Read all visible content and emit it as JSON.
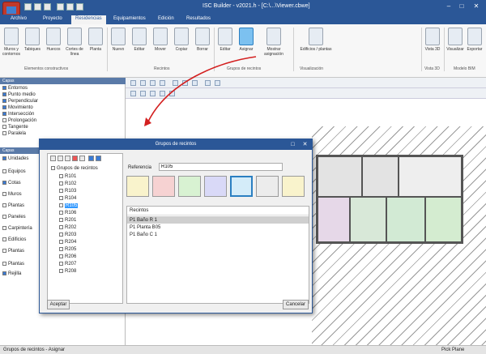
{
  "window": {
    "title": "ISC Builder - v2021.h - [C:\\...\\Viewer.cbwe]"
  },
  "tabs": [
    "Archivo",
    "Proyecto",
    "Residencias",
    "Equipamientos",
    "Edición",
    "Resultados"
  ],
  "ribbon": {
    "buttons": [
      "Muros y contornos",
      "Tabiques",
      "Huecos",
      "Cortes de línea",
      "Planta",
      "Nuevo",
      "Editar",
      "Mover",
      "Copiar",
      "Borrar",
      "Editar",
      "Asignar",
      "Mostrar asignación",
      "Edificios / plantas",
      "Vista 3D",
      "Visualizar",
      "Exportar"
    ],
    "groups": [
      "Elementos constructivos",
      "Recintos",
      "Grupos de recintos",
      "Visualización",
      "Vista 3D",
      "Modelo BIM"
    ]
  },
  "left_panel": {
    "header": "Capas",
    "items": [
      "Entornos",
      "Punto medio",
      "Perpendicular",
      "Movimiento",
      "Intersección",
      "Prolongación",
      "Tangente",
      "Paralela"
    ],
    "header2": "Capas",
    "items2": [
      "Unidades",
      "Equipos",
      "Cotas",
      "Muros",
      "Plantas",
      "Paneles",
      "Carpintería",
      "Edificios",
      "Plantas",
      "Plantas",
      "Rejilla"
    ]
  },
  "dialog": {
    "title": "Grupos de recintos",
    "tree_root": "Grupos de recintos",
    "tree_items": [
      "R101",
      "R102",
      "R103",
      "R104",
      "R105",
      "R106",
      "R201",
      "R202",
      "R203",
      "R204",
      "R205",
      "R206",
      "R207",
      "R208"
    ],
    "selected_item": "R105",
    "reference_label": "Referencia",
    "reference_value": "R105",
    "swatch_colors": [
      "#f9f3cc",
      "#f6d2d2",
      "#d8f2d2",
      "#d9d9f7",
      "#d4ecf9",
      "#ececec"
    ],
    "table_header": "Recintos",
    "table_rows": [
      "P1 Baño R 1",
      "P1 Planta B05",
      "P1 Baño C 1"
    ],
    "buttons": {
      "accept": "Aceptar",
      "cancel": "Cancelar"
    }
  },
  "status": {
    "left": "Grupos de recintos - Asignar",
    "right": "Pick Plane"
  }
}
